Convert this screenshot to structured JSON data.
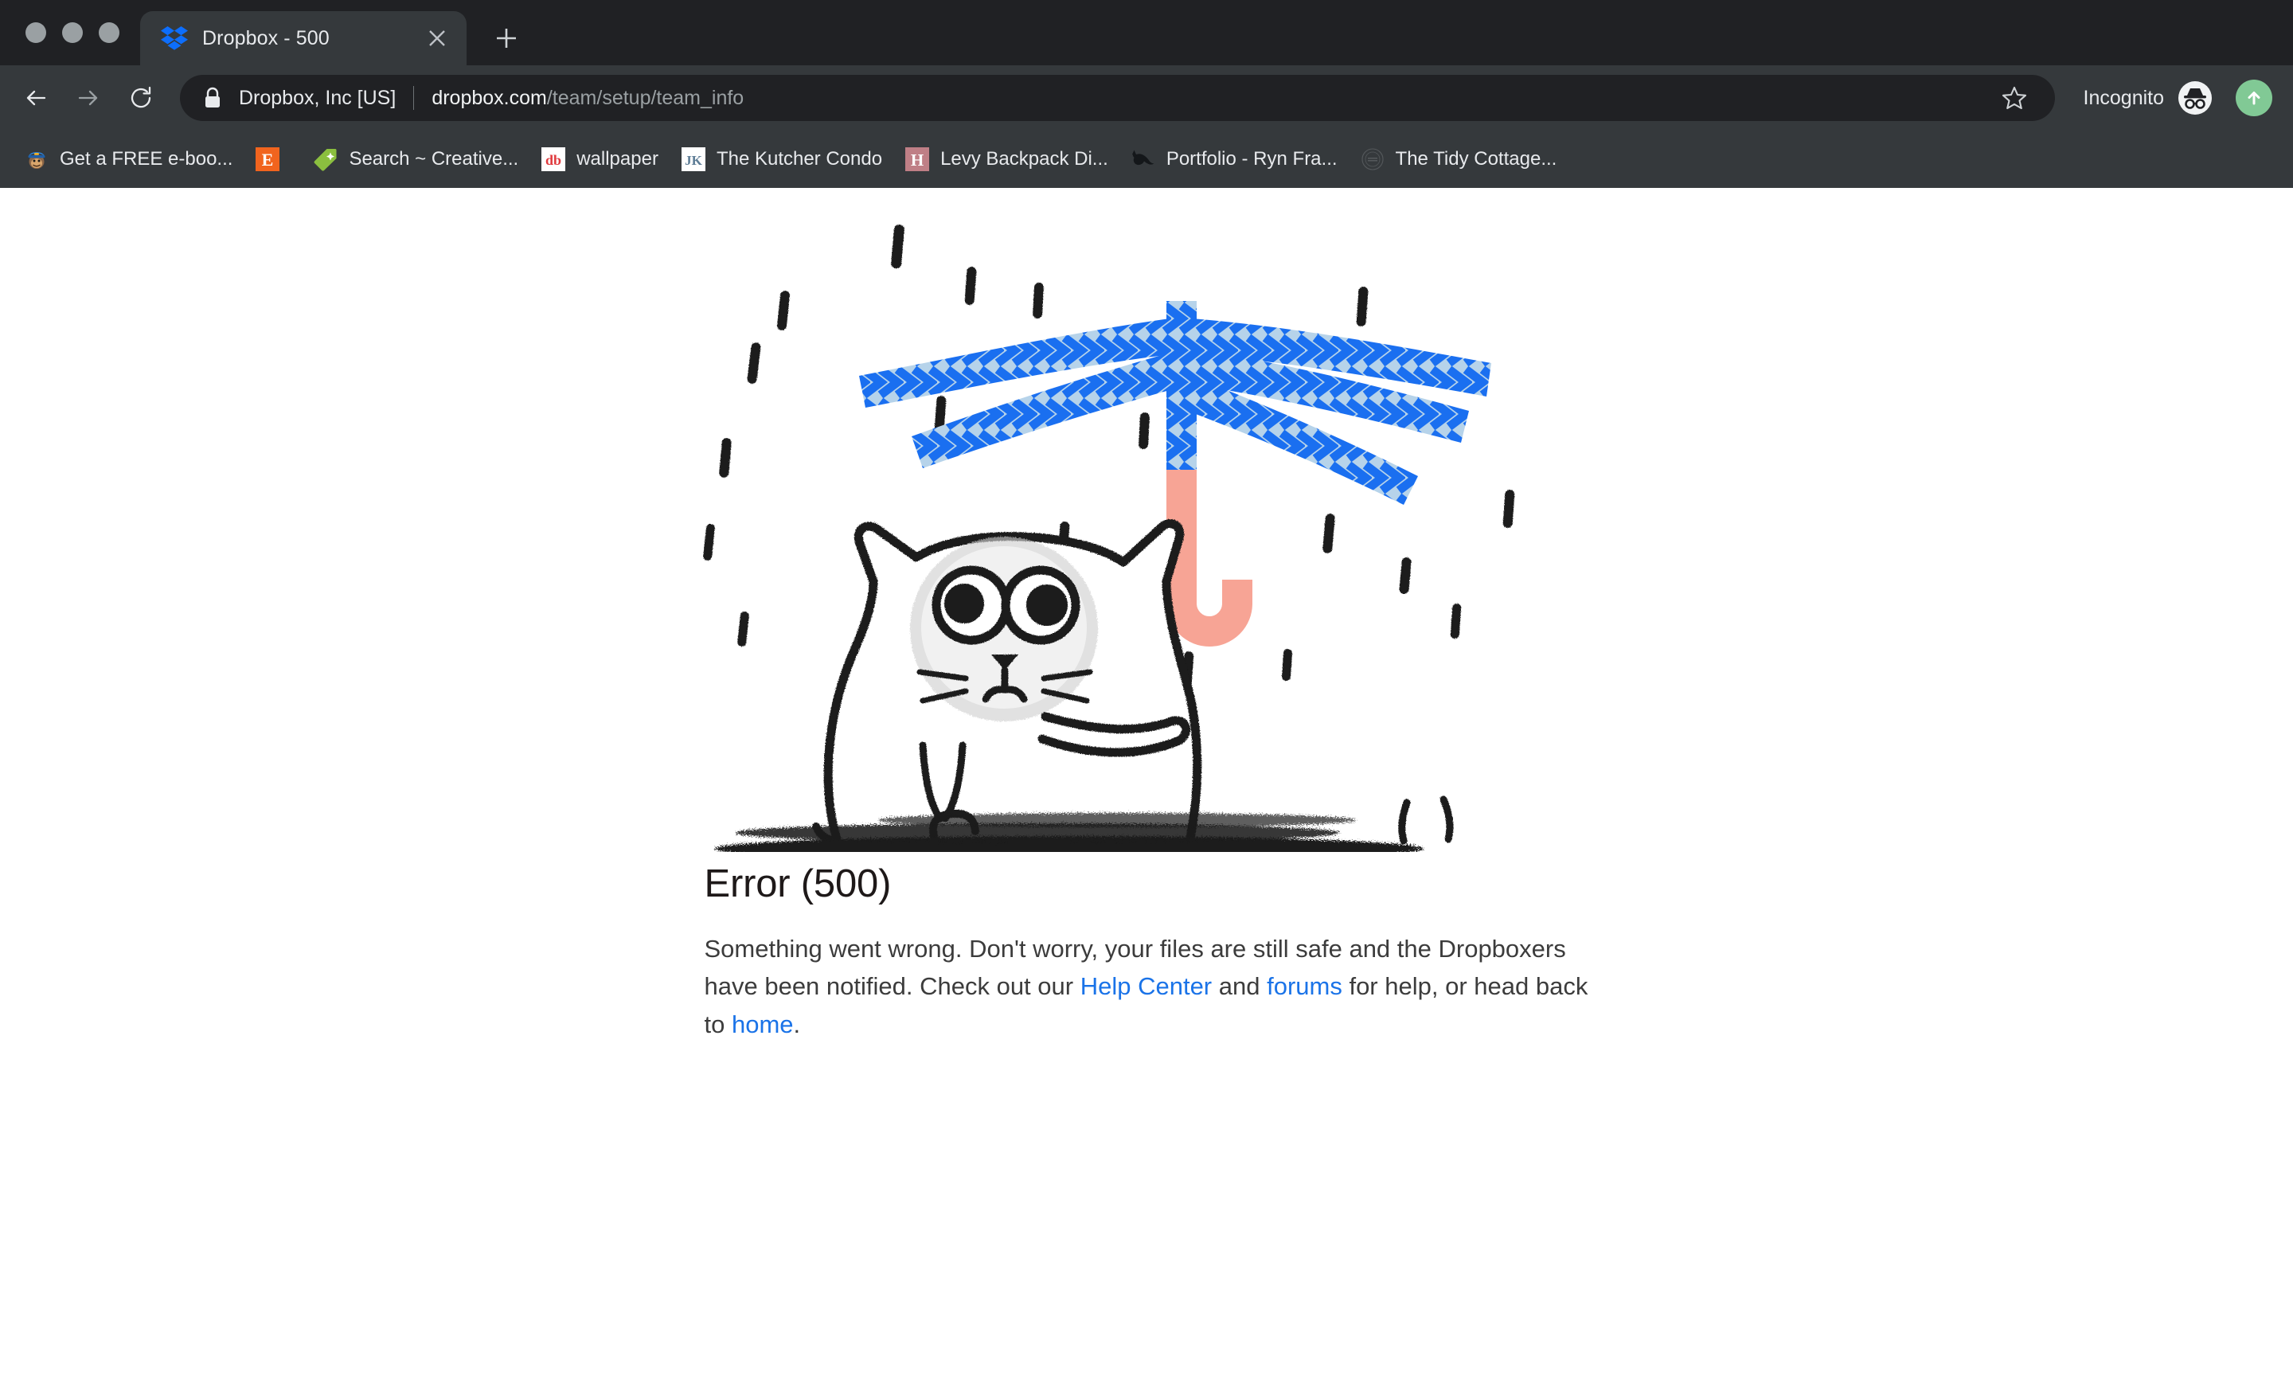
{
  "window": {
    "controls": [
      "close-dot",
      "minimize-dot",
      "maximize-dot"
    ]
  },
  "tab": {
    "title": "Dropbox - 500",
    "favicon": "dropbox-logo-icon",
    "close_icon": "close-icon",
    "newtab_icon": "plus-icon"
  },
  "toolbar": {
    "back_icon": "back-arrow-icon",
    "forward_icon": "forward-arrow-icon",
    "reload_icon": "reload-icon",
    "lock_icon": "lock-icon",
    "security_org": "Dropbox, Inc [US]",
    "url_host": "dropbox.com",
    "url_path": "/team/setup/team_info",
    "star_icon": "star-icon",
    "incognito_label": "Incognito",
    "incognito_icon": "incognito-icon",
    "profile_icon": "upload-arrow-icon",
    "accent_blue": "#1a73e8"
  },
  "bookmarks": [
    {
      "label": "Get a FREE e-boo...",
      "icon": "mailchimp-monkey-icon",
      "color": "#2d3e50"
    },
    {
      "label": "",
      "icon": "etsy-e-icon",
      "color": "#f1641e"
    },
    {
      "label": "Search ~ Creative...",
      "icon": "green-tag-icon",
      "color": "#8bbf3f"
    },
    {
      "label": "wallpaper",
      "icon": "designbyhumans-db-icon",
      "color": "#e03a3e"
    },
    {
      "label": "The Kutcher Condo",
      "icon": "jk-monogram-icon",
      "color": "#5e7d96"
    },
    {
      "label": "Levy Backpack Di...",
      "icon": "h-letter-icon",
      "color": "#bf7f86"
    },
    {
      "label": "Portfolio - Ryn Fra...",
      "icon": "fox-silhouette-icon",
      "color": "#14171a"
    },
    {
      "label": "The Tidy Cottage...",
      "icon": "tidy-cottage-stamp-icon",
      "color": "#4a4f52"
    }
  ],
  "page": {
    "illustration_name": "sad-cat-broken-umbrella-rain-illustration",
    "error_title": "Error (500)",
    "body_part1": "Something went wrong. Don't worry, your files are still safe and the Dropboxers have been notified. Check out our ",
    "link_help_center": "Help Center",
    "body_part2": " and ",
    "link_forums": "forums",
    "body_part3": " for help, or head back to ",
    "link_home": "home",
    "body_part4": ".",
    "colors": {
      "umbrella_light_blue": "#b6d3ea",
      "umbrella_bright_blue": "#1a6ff0",
      "umbrella_handle_pink": "#f7a495",
      "ink_black": "#1a1a1a",
      "background": "#ffffff"
    }
  }
}
